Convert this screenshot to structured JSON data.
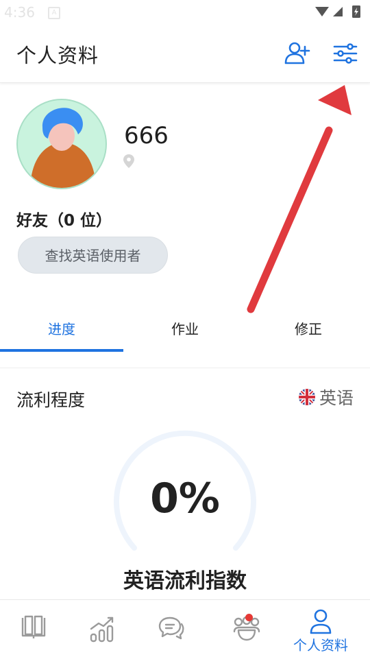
{
  "status": {
    "time": "4:36",
    "notif_letter": "A"
  },
  "header": {
    "title": "个人资料"
  },
  "profile": {
    "username": "666"
  },
  "friends": {
    "label": "好友（0 位）",
    "find_button": "查找英语使用者"
  },
  "tabs": [
    {
      "label": "进度",
      "active": true
    },
    {
      "label": "作业",
      "active": false
    },
    {
      "label": "修正",
      "active": false
    }
  ],
  "fluency": {
    "title": "流利程度",
    "language": "英语",
    "percent": "0%",
    "index_label": "英语流利指数"
  },
  "bottom_nav": {
    "active_label": "个人资料"
  },
  "colors": {
    "accent": "#1f73e0",
    "annotation_arrow": "#e03a3e",
    "badge": "#e53935"
  }
}
